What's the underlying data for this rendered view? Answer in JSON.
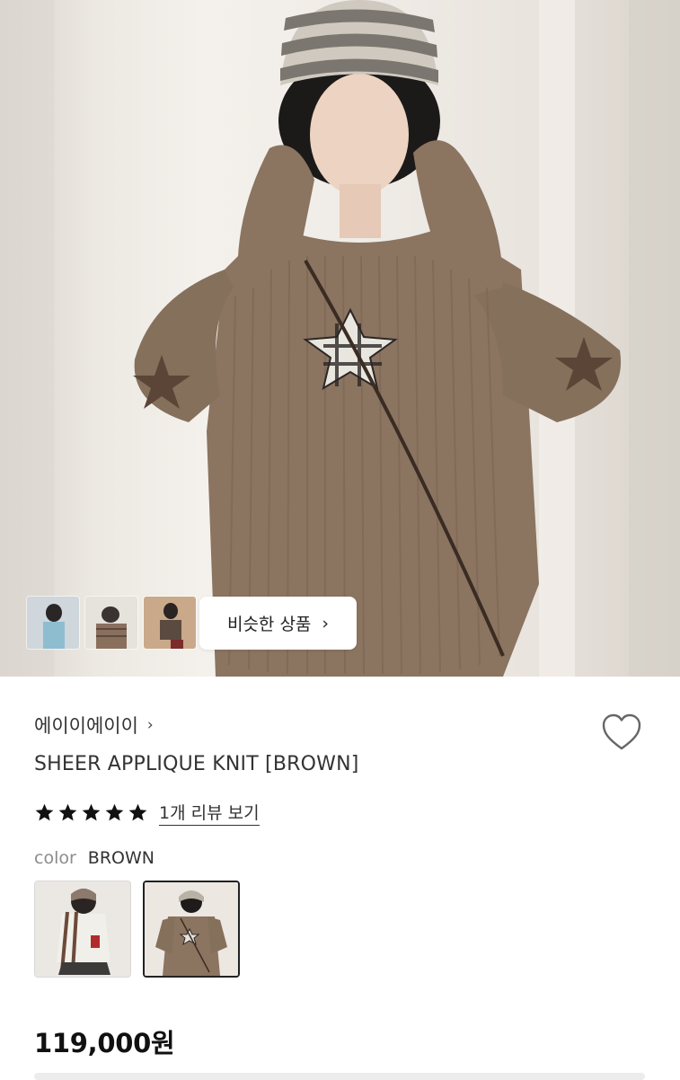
{
  "similar_button": {
    "label": "비슷한 상품",
    "chevron": "›"
  },
  "brand": {
    "name": "에이이에이이",
    "chevron": "›"
  },
  "product": {
    "title": "SHEER APPLIQUE KNIT [BROWN]",
    "price": "119,000원"
  },
  "rating": {
    "stars": 5,
    "review_link": "1개 리뷰 보기"
  },
  "color": {
    "label": "color",
    "value": "BROWN"
  },
  "icons": {
    "wishlist": "heart-outline-icon",
    "star": "star-filled-icon"
  },
  "colors": {
    "text_primary": "#222222",
    "text_muted": "#8c8c8c",
    "sweater": "#8b7460",
    "selected_border": "#222222"
  }
}
